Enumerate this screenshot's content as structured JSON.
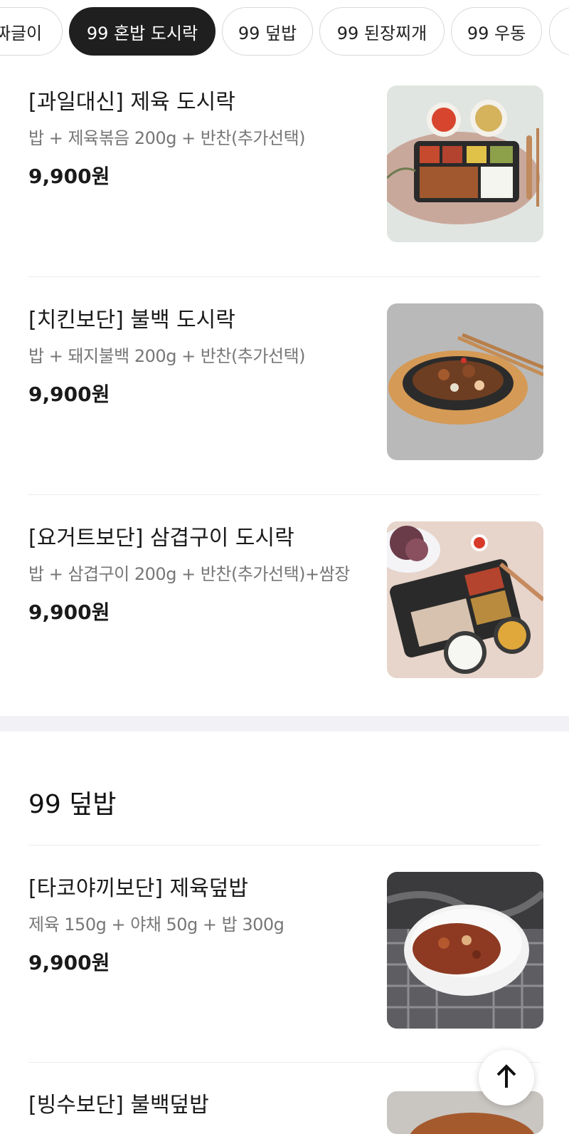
{
  "tabs": [
    {
      "label": "짜글이",
      "active": false
    },
    {
      "label": "99 혼밥 도시락",
      "active": true
    },
    {
      "label": "99 덮밥",
      "active": false
    },
    {
      "label": "99 된장찌개",
      "active": false
    },
    {
      "label": "99 우동",
      "active": false
    }
  ],
  "items": [
    {
      "name": "[과일대신] 제육 도시락",
      "desc": "밥 + 제육볶음 200g + 반찬(추가선택)",
      "price": "9,900원",
      "image": "jeyuk-dosirak-photo"
    },
    {
      "name": "[치킨보단] 불백 도시락",
      "desc": "밥 + 돼지불백 200g + 반찬(추가선택)",
      "price": "9,900원",
      "image": "bulbaek-platter-photo"
    },
    {
      "name": "[요거트보단] 삼겹구이 도시락",
      "desc": "밥 + 삼겹구이 200g + 반찬(추가선택)+쌈장",
      "price": "9,900원",
      "image": "samgyeop-dosirak-photo"
    }
  ],
  "section": {
    "title": "99 덮밥"
  },
  "deopbap_items": [
    {
      "name": "[타코야끼보단] 제육덮밥",
      "desc": "제육 150g + 야채 50g + 밥 300g",
      "price": "9,900원",
      "image": "jeyuk-deopbap-photo"
    },
    {
      "name": "[빙수보단] 불백덮밥",
      "image": "bulbaek-deopbap-photo"
    }
  ],
  "scroll_top_icon": "arrow-up-icon"
}
